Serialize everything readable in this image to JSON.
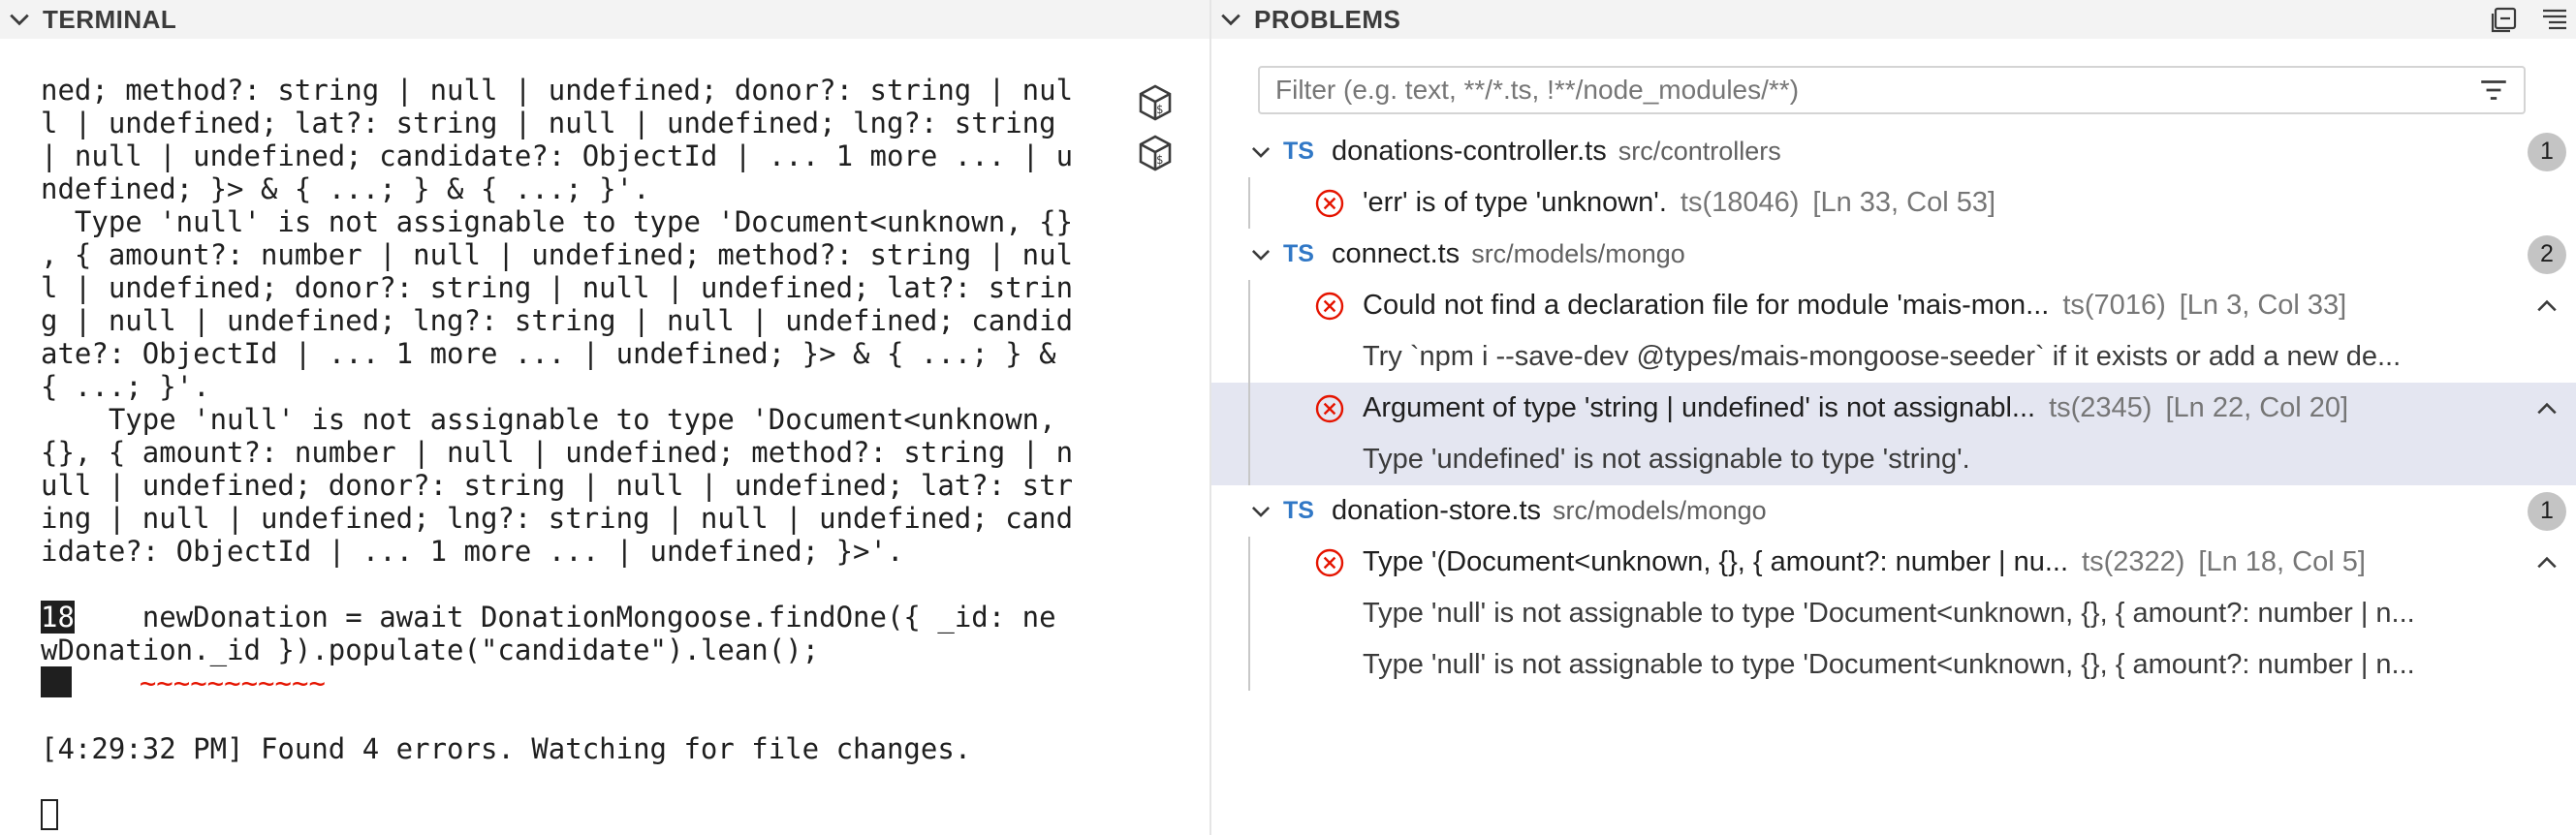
{
  "terminal": {
    "title": "TERMINAL",
    "lines": [
      "ned; method?: string | null | undefined; donor?: string | nul",
      "l | undefined; lat?: string | null | undefined; lng?: string",
      "| null | undefined; candidate?: ObjectId | ... 1 more ... | u",
      "ndefined; }> & { ...; } & { ...; }'.",
      "  Type 'null' is not assignable to type 'Document<unknown, {}",
      ", { amount?: number | null | undefined; method?: string | nul",
      "l | undefined; donor?: string | null | undefined; lat?: strin",
      "g | null | undefined; lng?: string | null | undefined; candid",
      "ate?: ObjectId | ... 1 more ... | undefined; }> & { ...; } &",
      "{ ...; }'.",
      "    Type 'null' is not assignable to type 'Document<unknown,",
      "{}, { amount?: number | null | undefined; method?: string | n",
      "ull | undefined; donor?: string | null | undefined; lat?: str",
      "ing | null | undefined; lng?: string | null | undefined; cand",
      "idate?: ObjectId | ... 1 more ... | undefined; }>'."
    ],
    "source_line_number": "18",
    "source_line_a": "    newDonation = await DonationMongoose.findOne({ _id: ne",
    "source_line_b": "wDonation._id }).populate(\"candidate\").lean();",
    "squiggle_pre": "    ",
    "squiggle_text": "~~~~~~~~~~~",
    "status_line": "[4:29:32 PM] Found 4 errors. Watching for file changes."
  },
  "problems": {
    "title": "PROBLEMS",
    "filter_placeholder": "Filter (e.g. text, **/*.ts, !**/node_modules/**)",
    "groups": [
      {
        "badge": "TS",
        "file": "donations-controller.ts",
        "path": "src/controllers",
        "count": "1",
        "items": [
          {
            "message": "'err' is of type 'unknown'.",
            "code": "ts(18046)",
            "loc": "[Ln 33, Col 53]"
          }
        ]
      },
      {
        "badge": "TS",
        "file": "connect.ts",
        "path": "src/models/mongo",
        "count": "2",
        "items": [
          {
            "message": "Could not find a declaration file for module 'mais-mon...",
            "code": "ts(7016)",
            "loc": "[Ln 3, Col 33]",
            "details": [
              "Try `npm i --save-dev @types/mais-mongoose-seeder` if it exists or add a new de..."
            ]
          },
          {
            "message": "Argument of type 'string | undefined' is not assignabl...",
            "code": "ts(2345)",
            "loc": "[Ln 22, Col 20]",
            "details": [
              "Type 'undefined' is not assignable to type 'string'."
            ]
          }
        ]
      },
      {
        "badge": "TS",
        "file": "donation-store.ts",
        "path": "src/models/mongo",
        "count": "1",
        "items": [
          {
            "message": "Type '(Document<unknown, {}, { amount?: number | nu...",
            "code": "ts(2322)",
            "loc": "[Ln 18, Col 5]",
            "details": [
              "Type 'null' is not assignable to type 'Document<unknown, {}, { amount?: number | n...",
              "Type 'null' is not assignable to type 'Document<unknown, {}, { amount?: number | n..."
            ]
          }
        ]
      }
    ]
  },
  "colors": {
    "error": "#e51400",
    "ts_blue": "#3178c6",
    "selection": "#e4e6f1"
  }
}
